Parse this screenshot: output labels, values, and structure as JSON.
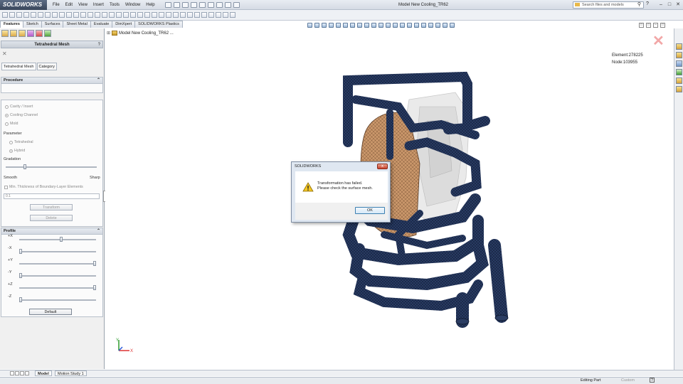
{
  "app": {
    "name": "SOLIDWORKS",
    "document_title": "Model New Cooling_TR62"
  },
  "menu": [
    "File",
    "Edit",
    "View",
    "Insert",
    "Tools",
    "Window",
    "Help"
  ],
  "search": {
    "placeholder": "Search files and models"
  },
  "command_tabs": [
    "Features",
    "Sketch",
    "Surfaces",
    "Sheet Metal",
    "Evaluate",
    "DimXpert",
    "SOLIDWORKS Plastics"
  ],
  "property_manager": {
    "title": "Tetrahedral Mesh",
    "help": "?",
    "tabs": [
      "Tetrahedral Mesh",
      "Category"
    ],
    "procedure": {
      "header": "Procedure",
      "options": [
        "Cavity / Insert",
        "Cooling Channel",
        "Mold"
      ],
      "selected": "Cooling Channel",
      "parameter_label": "Parameter",
      "parameter_options": [
        "Tetrahedral",
        "Hybrid"
      ],
      "parameter_selected": "Hybrid",
      "gradation_label": "Gradation",
      "gradation_level": 0.2,
      "smooth_label": "Smooth",
      "sharp_label": "Sharp",
      "boundary_label": "Min. Thickness of Boundary-Layer Elements",
      "boundary_value": "0.1",
      "transform_button": "Transform",
      "delete_button": "Delete"
    },
    "profile": {
      "header": "Profile",
      "sliders": [
        {
          "label": "+X",
          "level": 0.55
        },
        {
          "label": "-X",
          "level": 0.0
        },
        {
          "label": "+Y",
          "level": 1.0
        },
        {
          "label": "-Y",
          "level": 0.0
        },
        {
          "label": "+Z",
          "level": 1.0
        },
        {
          "label": "-Z",
          "level": 0.0
        }
      ],
      "default_button": "Default"
    }
  },
  "tree": {
    "root": "Model New Cooling_TR62 ..."
  },
  "stats": {
    "element": "Element:278225",
    "node": "Node:103955"
  },
  "dialog": {
    "title": "SOLIDWORKS",
    "close": "x",
    "message_line1": "Transformation has failed.",
    "message_line2": "Please check the surface mesh.",
    "ok": "OK"
  },
  "bottom_tabs": [
    "Model",
    "Motion Study 1"
  ],
  "status": {
    "mode": "Editing Part",
    "units": "Custom",
    "help": "?"
  },
  "triad": {
    "x_label": "X",
    "y_label": "Y"
  },
  "colors": {
    "mesh_pipe": "#1c2a4a",
    "mesh_insert": "#c9966a",
    "mesh_ghost": "#cfcfcf",
    "close_red": "#c8412b"
  }
}
